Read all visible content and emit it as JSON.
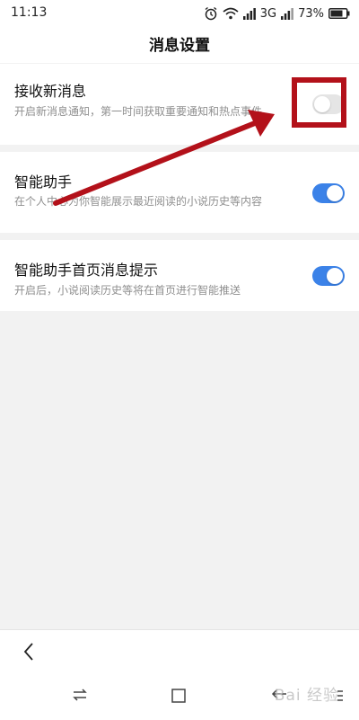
{
  "status_bar": {
    "time": "11:13",
    "network": "3G",
    "battery": "73%",
    "icons": [
      "alarm-icon",
      "wifi-icon",
      "signal-icon",
      "signal-icon",
      "battery-icon"
    ]
  },
  "header": {
    "title": "消息设置"
  },
  "settings": [
    {
      "title": "接收新消息",
      "description": "开启新消息通知，第一时间获取重要通知和热点事件",
      "enabled": false
    },
    {
      "title": "智能助手",
      "description": "在个人中心为你智能展示最近阅读的小说历史等内容",
      "enabled": true
    },
    {
      "title": "智能助手首页消息提示",
      "description": "开启后，小说阅读历史等将在首页进行智能推送",
      "enabled": true
    }
  ],
  "colors": {
    "toggle_on": "#3b82e8",
    "toggle_off": "#e5e5e5",
    "annotation": "#b3111a"
  },
  "nav_icons": [
    "back-chevron-icon",
    "switch-apps-icon",
    "home-square-icon",
    "back-arrow-icon",
    "menu-icon"
  ],
  "watermark": "Bai 经验"
}
